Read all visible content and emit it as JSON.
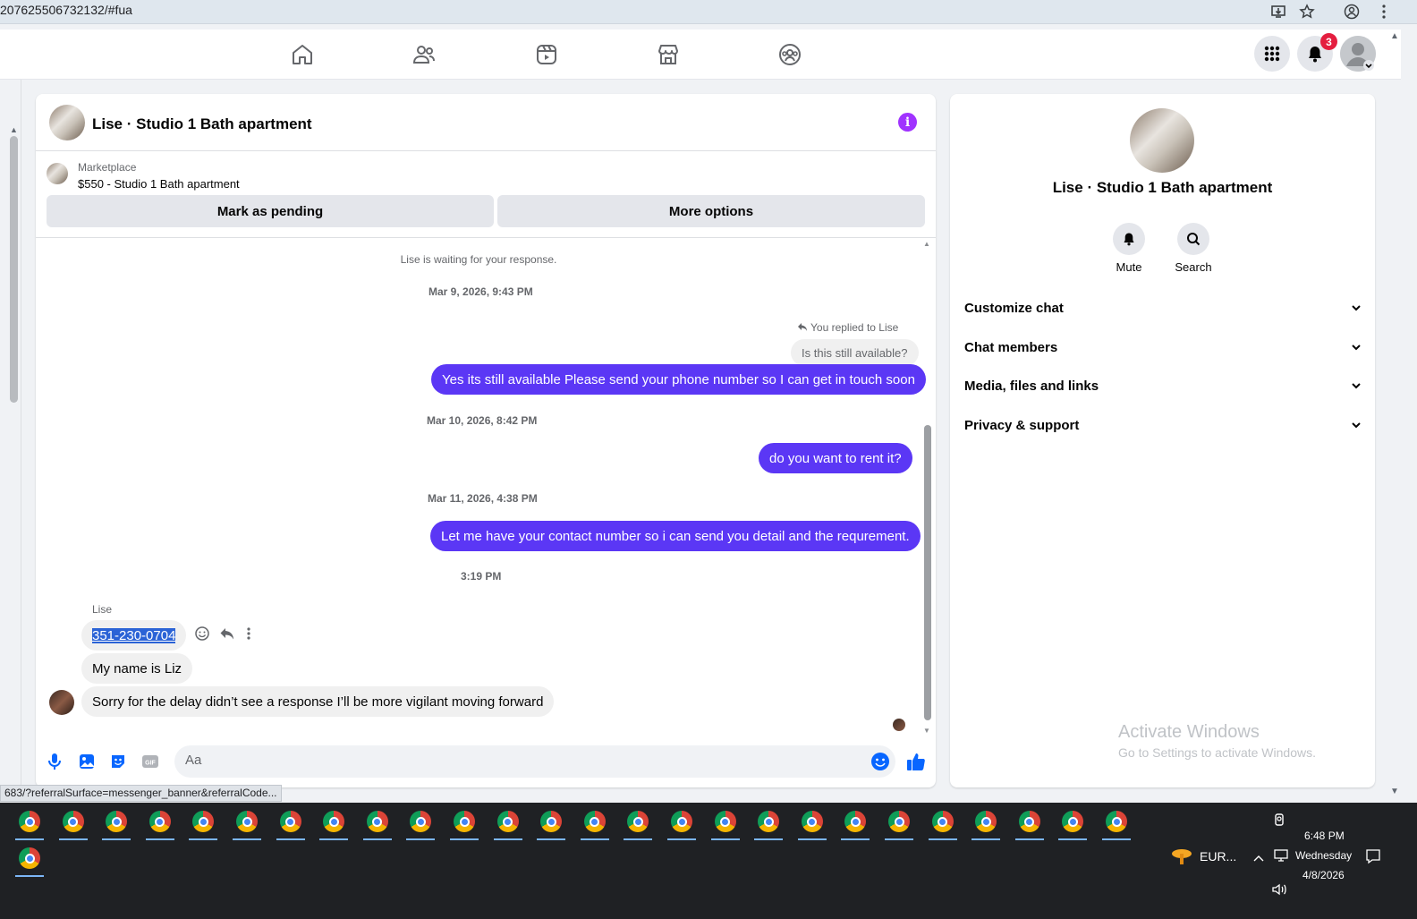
{
  "browser": {
    "url": "207625506732132/#fua"
  },
  "nav": {
    "notification_count": "3"
  },
  "chat": {
    "title": "Lise · Studio 1 Bath apartment",
    "marketplace": {
      "label": "Marketplace",
      "listing": "$550 - Studio 1 Bath apartment",
      "mark_pending": "Mark as pending",
      "more_options": "More options"
    },
    "waiting": "Lise is waiting for your response.",
    "timestamps": {
      "t1": "Mar 9, 2026, 9:43 PM",
      "t2": "Mar 10, 2026, 8:42 PM",
      "t3": "Mar 11, 2026, 4:38 PM",
      "t4": "3:19 PM"
    },
    "replied_to": "You replied to Lise",
    "quoted": "Is this still available?",
    "outgoing": [
      "Yes its still available Please send your phone number so I can get in touch soon",
      "do you want to rent it?",
      "Let me have your contact number so i can send you detail and the requrement."
    ],
    "sender_name": "Lise",
    "incoming": [
      "351-230-0704",
      "My name is Liz",
      "Sorry for the delay didn’t see a response I’ll be more vigilant moving forward"
    ],
    "input_placeholder": "Aa"
  },
  "right_panel": {
    "name": "Lise · Studio 1 Bath apartment",
    "mute_label": "Mute",
    "search_label": "Search",
    "sections": [
      "Customize chat",
      "Chat members",
      "Media, files and links",
      "Privacy & support"
    ],
    "watermark_title": "Activate Windows",
    "watermark_sub": "Go to Settings to activate Windows."
  },
  "status_url": "683/?referralSurface=messenger_banner&referralCode...",
  "taskbar": {
    "weather": "EUR...",
    "time": "6:48 PM",
    "day": "Wednesday",
    "date": "4/8/2026"
  },
  "colors": {
    "outgoing_bubble": "#5b37f5",
    "accent": "#0866ff",
    "info": "#a033ff",
    "badge": "#e41e3f"
  }
}
